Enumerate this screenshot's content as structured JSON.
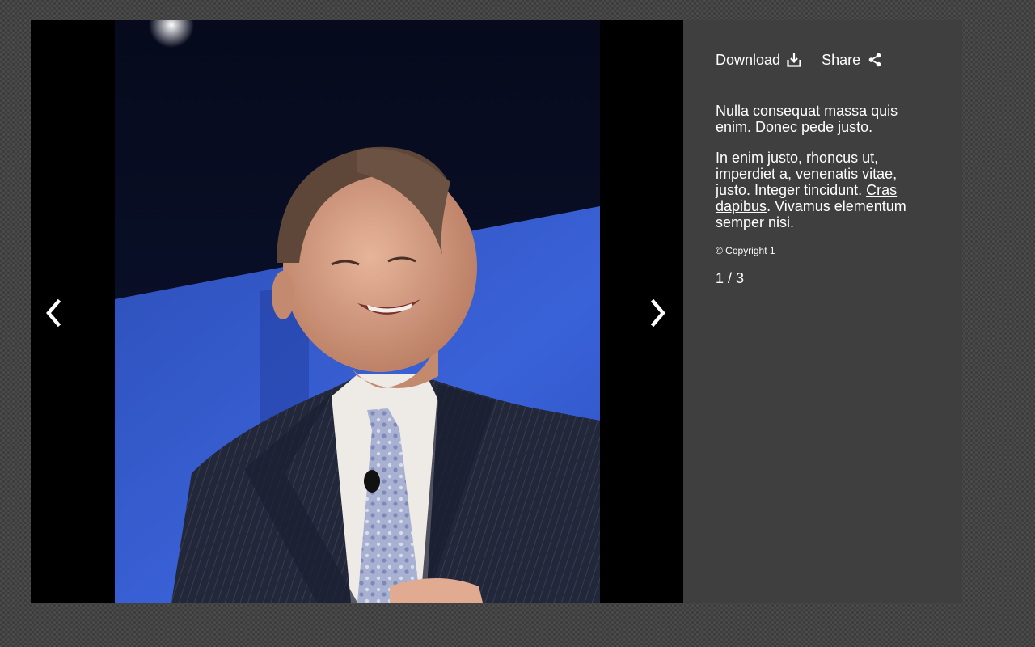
{
  "toolbar": {
    "download_label": "Download",
    "share_label": "Share",
    "download_icon": "download-icon",
    "share_icon": "share-icon"
  },
  "navigation": {
    "prev_icon": "chevron-left-icon",
    "next_icon": "chevron-right-icon"
  },
  "description": {
    "para1": "Nulla consequat massa quis enim. Donec pede justo.",
    "para2_before": "In enim justo, rhoncus ut, imperdiet a, venenatis vitae, justo. Integer tincidunt. ",
    "para2_link": "Cras dapibus",
    "para2_after": ". Vivamus elementum semper nisi."
  },
  "copyright": "© Copyright 1",
  "counter": "1 / 3",
  "colors": {
    "overlay": "#4a4a4a",
    "panel": "#3f3f3f",
    "stage": "#000000",
    "text": "#ffffff",
    "photo_backdrop": "#2f55cc"
  }
}
